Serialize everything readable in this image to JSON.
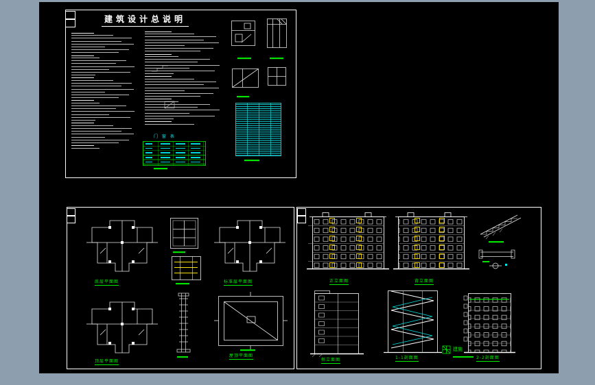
{
  "page": {
    "background": "#8d9eae",
    "canvas_background": "#000000"
  },
  "colors": {
    "linework": "#ffffff",
    "accent_green": "#00ef00",
    "accent_cyan": "#17d9d9",
    "accent_yellow": "#ffe100"
  },
  "sheet1": {
    "title": "建筑设计总说明",
    "schedule_title": "门 窗 表"
  },
  "sheet2_left": {
    "labels": {
      "plan1": "底层平面图",
      "plan2": "标准层平面图",
      "plan3": "顶层平面图",
      "roof": "屋顶平面图"
    }
  },
  "sheet2_right": {
    "labels": {
      "elev1": "正立面图",
      "elev2": "背立面图",
      "section1": "侧立面图",
      "stair": "1-1剖面图",
      "section3": "2-2剖面图",
      "title_block": "建施"
    }
  }
}
